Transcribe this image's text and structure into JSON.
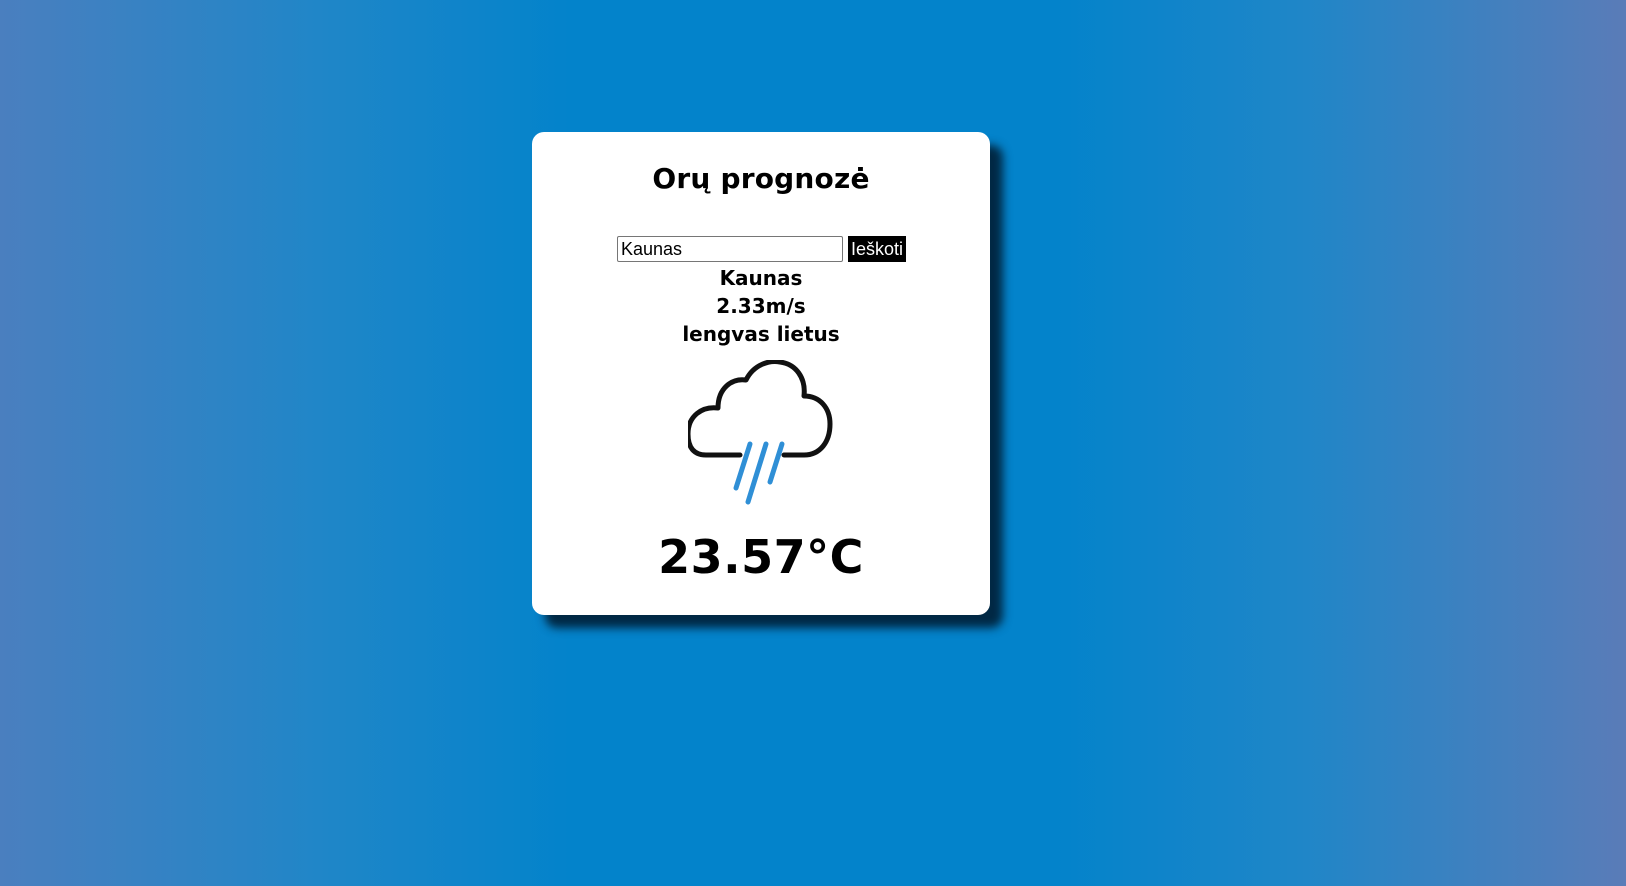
{
  "app": {
    "title": "Orų prognozė"
  },
  "search": {
    "value": "Kaunas",
    "button_label": "Ieškoti"
  },
  "weather": {
    "city": "Kaunas",
    "wind_speed": "2.33m/s",
    "description": "lengvas lietus",
    "icon": "rain-cloud-icon",
    "temperature": "23.57°C"
  },
  "colors": {
    "background": "#0383cb",
    "card": "#ffffff",
    "rain": "#2f8fd6",
    "button": "#000000"
  }
}
